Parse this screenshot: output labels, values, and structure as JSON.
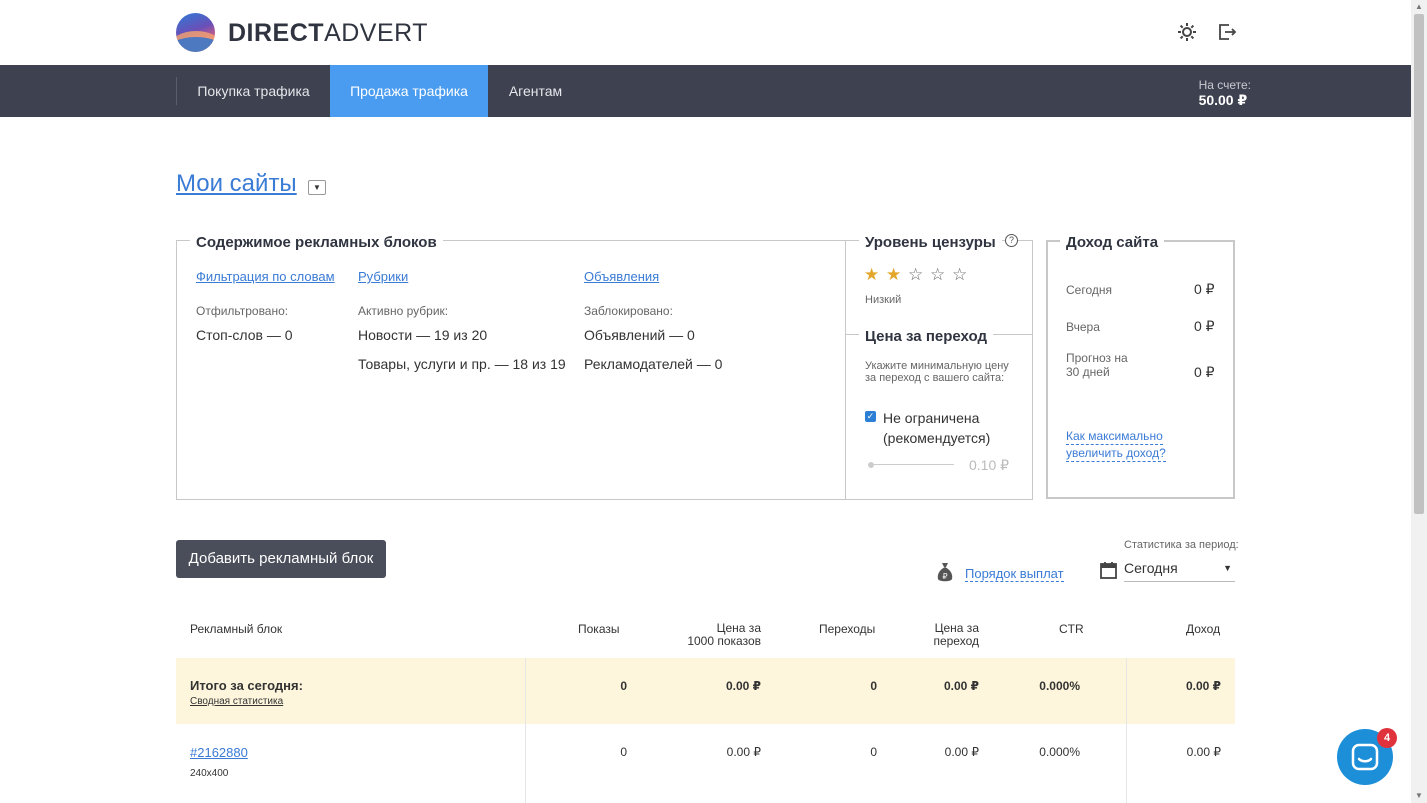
{
  "brand": {
    "bold": "DIRECT",
    "light": "ADVERT"
  },
  "header": {
    "icons": [
      "gear-icon",
      "logout-icon"
    ]
  },
  "nav": {
    "items": [
      {
        "label": "Покупка трафика",
        "active": false
      },
      {
        "label": "Продажа трафика",
        "active": true
      },
      {
        "label": "Агентам",
        "active": false
      }
    ],
    "balance_label": "На счете:",
    "balance_value": "50.00 ₽"
  },
  "page": {
    "title": "Мои сайты"
  },
  "content_box": {
    "title": "Содержимое рекламных блоков",
    "col1": {
      "link": "Фильтрация по словам",
      "label": "Отфильтровано:",
      "lines": [
        "Стоп-слов — 0"
      ]
    },
    "col2": {
      "link": "Рубрики",
      "label": "Активно рубрик:",
      "lines": [
        "Новости — 19 из 20",
        "Товары, услуги и пр. — 18 из 19"
      ]
    },
    "col3": {
      "link": "Объявления",
      "label": "Заблокировано:",
      "lines": [
        "Объявлений — 0",
        "Рекламодателей — 0"
      ]
    }
  },
  "censor": {
    "title": "Уровень цензуры",
    "stars_total": 5,
    "stars_on": 2,
    "level_label": "Низкий"
  },
  "price": {
    "title": "Цена за переход",
    "hint": [
      "Укажите минимальную цену",
      "за переход с вашего сайта:"
    ],
    "checkbox_label": [
      "Не ограничена",
      "(рекомендуется)"
    ],
    "checked": true,
    "slider_value": "0.10 ₽"
  },
  "income": {
    "title": "Доход сайта",
    "rows": [
      {
        "label": "Сегодня",
        "value": "0 ₽"
      },
      {
        "label": "Вчера",
        "value": "0 ₽"
      },
      {
        "label": "Прогноз на 30 дней",
        "label_lines": [
          "Прогноз на",
          "30 дней"
        ],
        "value": "0 ₽"
      }
    ],
    "link": [
      "Как максимально",
      "увеличить доход?"
    ]
  },
  "toolbar": {
    "add_button": "Добавить рекламный блок",
    "payout_link": "Порядок выплат",
    "period_label": "Статистика за период:",
    "period_value": "Сегодня"
  },
  "table": {
    "headers": {
      "block": "Рекламный блок",
      "shows": "Показы",
      "cpm": [
        "Цена за",
        "1000 показов"
      ],
      "clicks": "Переходы",
      "cpc": [
        "Цена за",
        "переход"
      ],
      "ctr": "CTR",
      "income": "Доход"
    },
    "total": {
      "label": "Итого за сегодня:",
      "sub_link": "Сводная статистика",
      "shows": "0",
      "cpm": "0.00 ₽",
      "clicks": "0",
      "cpc": "0.00 ₽",
      "ctr": "0.000%",
      "income": "0.00 ₽"
    },
    "rows": [
      {
        "id": "#2162880",
        "size": "240x400",
        "shows": "0",
        "cpm": "0.00 ₽",
        "clicks": "0",
        "cpc": "0.00 ₽",
        "ctr": "0.000%",
        "income": "0.00 ₽"
      }
    ]
  },
  "chat": {
    "badge": "4"
  }
}
